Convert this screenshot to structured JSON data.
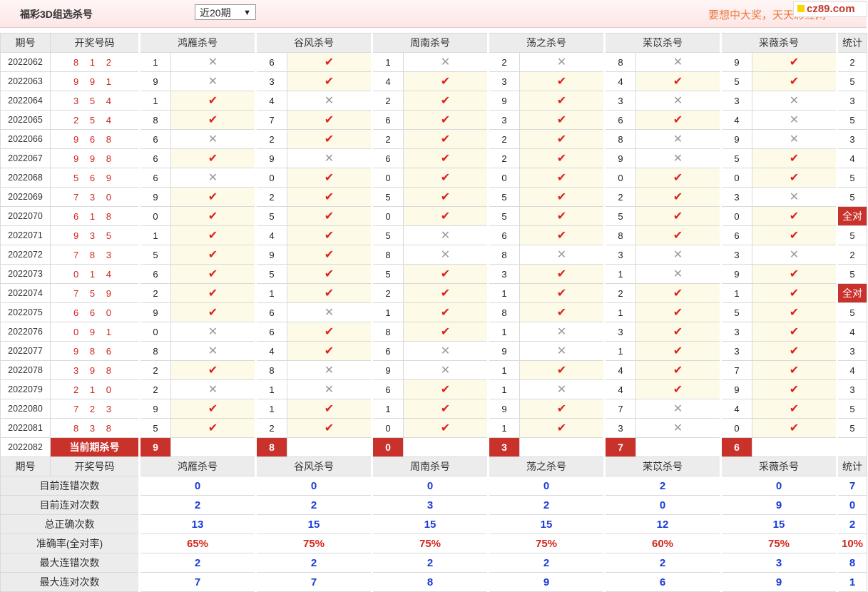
{
  "header": {
    "title": "福彩3D组选杀号",
    "period_select": "近20期",
    "slogan": "要想中大奖，天天彩经网",
    "logo": "cz89.com"
  },
  "columns": {
    "issue": "期号",
    "draw": "开奖号码",
    "experts": [
      "鸿雁杀号",
      "谷风杀号",
      "周南杀号",
      "荡之杀号",
      "苿苡杀号",
      "采薇杀号"
    ],
    "stats": "统计"
  },
  "icons": {
    "correct": "check-icon",
    "wrong": "cross-icon"
  },
  "rows": [
    {
      "issue": "2022062",
      "draw": "8 1 2",
      "cells": [
        [
          "1",
          0
        ],
        [
          "6",
          1
        ],
        [
          "1",
          0
        ],
        [
          "2",
          0
        ],
        [
          "8",
          0
        ],
        [
          "9",
          1
        ]
      ],
      "total": "2"
    },
    {
      "issue": "2022063",
      "draw": "9 9 1",
      "cells": [
        [
          "9",
          0
        ],
        [
          "3",
          1
        ],
        [
          "4",
          1
        ],
        [
          "3",
          1
        ],
        [
          "4",
          1
        ],
        [
          "5",
          1
        ]
      ],
      "total": "5"
    },
    {
      "issue": "2022064",
      "draw": "3 5 4",
      "cells": [
        [
          "1",
          1
        ],
        [
          "4",
          0
        ],
        [
          "2",
          1
        ],
        [
          "9",
          1
        ],
        [
          "3",
          0
        ],
        [
          "3",
          0
        ]
      ],
      "total": "3"
    },
    {
      "issue": "2022065",
      "draw": "2 5 4",
      "cells": [
        [
          "8",
          1
        ],
        [
          "7",
          1
        ],
        [
          "6",
          1
        ],
        [
          "3",
          1
        ],
        [
          "6",
          1
        ],
        [
          "4",
          0
        ]
      ],
      "total": "5"
    },
    {
      "issue": "2022066",
      "draw": "9 6 8",
      "cells": [
        [
          "6",
          0
        ],
        [
          "2",
          1
        ],
        [
          "2",
          1
        ],
        [
          "2",
          1
        ],
        [
          "8",
          0
        ],
        [
          "9",
          0
        ]
      ],
      "total": "3"
    },
    {
      "issue": "2022067",
      "draw": "9 9 8",
      "cells": [
        [
          "6",
          1
        ],
        [
          "9",
          0
        ],
        [
          "6",
          1
        ],
        [
          "2",
          1
        ],
        [
          "9",
          0
        ],
        [
          "5",
          1
        ]
      ],
      "total": "4"
    },
    {
      "issue": "2022068",
      "draw": "5 6 9",
      "cells": [
        [
          "6",
          0
        ],
        [
          "0",
          1
        ],
        [
          "0",
          1
        ],
        [
          "0",
          1
        ],
        [
          "0",
          1
        ],
        [
          "0",
          1
        ]
      ],
      "total": "5"
    },
    {
      "issue": "2022069",
      "draw": "7 3 0",
      "cells": [
        [
          "9",
          1
        ],
        [
          "2",
          1
        ],
        [
          "5",
          1
        ],
        [
          "5",
          1
        ],
        [
          "2",
          1
        ],
        [
          "3",
          0
        ]
      ],
      "total": "5"
    },
    {
      "issue": "2022070",
      "draw": "6 1 8",
      "cells": [
        [
          "0",
          1
        ],
        [
          "5",
          1
        ],
        [
          "0",
          1
        ],
        [
          "5",
          1
        ],
        [
          "5",
          1
        ],
        [
          "0",
          1
        ]
      ],
      "total": "全对"
    },
    {
      "issue": "2022071",
      "draw": "9 3 5",
      "cells": [
        [
          "1",
          1
        ],
        [
          "4",
          1
        ],
        [
          "5",
          0
        ],
        [
          "6",
          1
        ],
        [
          "8",
          1
        ],
        [
          "6",
          1
        ]
      ],
      "total": "5"
    },
    {
      "issue": "2022072",
      "draw": "7 8 3",
      "cells": [
        [
          "5",
          1
        ],
        [
          "9",
          1
        ],
        [
          "8",
          0
        ],
        [
          "8",
          0
        ],
        [
          "3",
          0
        ],
        [
          "3",
          0
        ]
      ],
      "total": "2"
    },
    {
      "issue": "2022073",
      "draw": "0 1 4",
      "cells": [
        [
          "6",
          1
        ],
        [
          "5",
          1
        ],
        [
          "5",
          1
        ],
        [
          "3",
          1
        ],
        [
          "1",
          0
        ],
        [
          "9",
          1
        ]
      ],
      "total": "5"
    },
    {
      "issue": "2022074",
      "draw": "7 5 9",
      "cells": [
        [
          "2",
          1
        ],
        [
          "1",
          1
        ],
        [
          "2",
          1
        ],
        [
          "1",
          1
        ],
        [
          "2",
          1
        ],
        [
          "1",
          1
        ]
      ],
      "total": "全对"
    },
    {
      "issue": "2022075",
      "draw": "6 6 0",
      "cells": [
        [
          "9",
          1
        ],
        [
          "6",
          0
        ],
        [
          "1",
          1
        ],
        [
          "8",
          1
        ],
        [
          "1",
          1
        ],
        [
          "5",
          1
        ]
      ],
      "total": "5"
    },
    {
      "issue": "2022076",
      "draw": "0 9 1",
      "cells": [
        [
          "0",
          0
        ],
        [
          "6",
          1
        ],
        [
          "8",
          1
        ],
        [
          "1",
          0
        ],
        [
          "3",
          1
        ],
        [
          "3",
          1
        ]
      ],
      "total": "4"
    },
    {
      "issue": "2022077",
      "draw": "9 8 6",
      "cells": [
        [
          "8",
          0
        ],
        [
          "4",
          1
        ],
        [
          "6",
          0
        ],
        [
          "9",
          0
        ],
        [
          "1",
          1
        ],
        [
          "3",
          1
        ]
      ],
      "total": "3"
    },
    {
      "issue": "2022078",
      "draw": "3 9 8",
      "cells": [
        [
          "2",
          1
        ],
        [
          "8",
          0
        ],
        [
          "9",
          0
        ],
        [
          "1",
          1
        ],
        [
          "4",
          1
        ],
        [
          "7",
          1
        ]
      ],
      "total": "4"
    },
    {
      "issue": "2022079",
      "draw": "2 1 0",
      "cells": [
        [
          "2",
          0
        ],
        [
          "1",
          0
        ],
        [
          "6",
          1
        ],
        [
          "1",
          0
        ],
        [
          "4",
          1
        ],
        [
          "9",
          1
        ]
      ],
      "total": "3"
    },
    {
      "issue": "2022080",
      "draw": "7 2 3",
      "cells": [
        [
          "9",
          1
        ],
        [
          "1",
          1
        ],
        [
          "1",
          1
        ],
        [
          "9",
          1
        ],
        [
          "7",
          0
        ],
        [
          "4",
          1
        ]
      ],
      "total": "5"
    },
    {
      "issue": "2022081",
      "draw": "8 3 8",
      "cells": [
        [
          "5",
          1
        ],
        [
          "2",
          1
        ],
        [
          "0",
          1
        ],
        [
          "1",
          1
        ],
        [
          "3",
          0
        ],
        [
          "0",
          1
        ]
      ],
      "total": "5"
    }
  ],
  "current": {
    "issue": "2022082",
    "label": "当前期杀号",
    "picks": [
      "9",
      "8",
      "0",
      "3",
      "7",
      "6"
    ]
  },
  "summary": [
    {
      "label": "目前连错次数",
      "values": [
        "0",
        "0",
        "0",
        "0",
        "2",
        "0"
      ],
      "stat": "7",
      "style": "sval"
    },
    {
      "label": "目前连对次数",
      "values": [
        "2",
        "2",
        "3",
        "2",
        "0",
        "9"
      ],
      "stat": "0",
      "style": "sval"
    },
    {
      "label": "总正确次数",
      "values": [
        "13",
        "15",
        "15",
        "15",
        "12",
        "15"
      ],
      "stat": "2",
      "style": "sval"
    },
    {
      "label": "准确率(全对率)",
      "values": [
        "65%",
        "75%",
        "75%",
        "75%",
        "60%",
        "75%"
      ],
      "stat": "10%",
      "style": "rate"
    },
    {
      "label": "最大连错次数",
      "values": [
        "2",
        "2",
        "2",
        "2",
        "2",
        "3"
      ],
      "stat": "8",
      "style": "sval"
    },
    {
      "label": "最大连对次数",
      "values": [
        "7",
        "7",
        "8",
        "9",
        "6",
        "9"
      ],
      "stat": "1",
      "style": "sval"
    }
  ]
}
